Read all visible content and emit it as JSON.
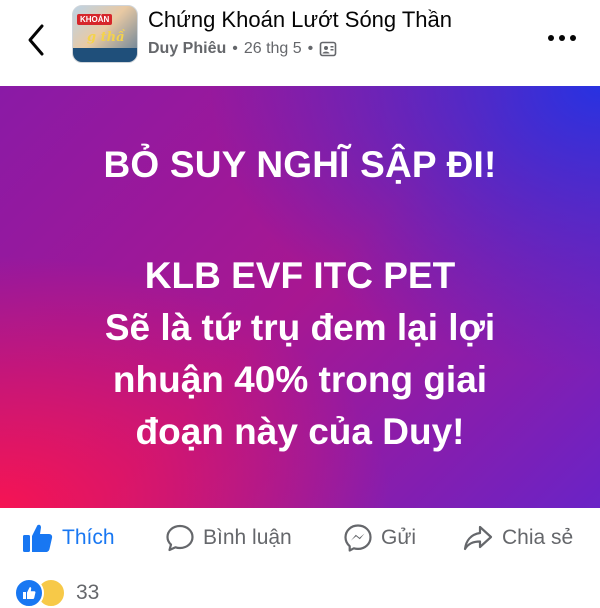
{
  "header": {
    "group_name": "Chứng Khoán Lướt Sóng Thần",
    "author": "Duy Phiêu",
    "separator": "•",
    "date": "26 thg 5",
    "icons": {
      "back": "back-chevron-icon",
      "privacy": "group-privacy-icon",
      "more": "more-dots-icon"
    }
  },
  "avatar": {
    "tag_text": "KHOÁN",
    "script_text": "g thầ"
  },
  "post": {
    "line1": "BỎ SUY NGHĨ SẬP ĐI!",
    "line2": "KLB EVF ITC PET",
    "line3": "Sẽ là tứ trụ đem lại lợi",
    "line4": "nhuận 40% trong giai",
    "line5": "đoạn này của Duy!",
    "colors": {
      "text": "#ffffff",
      "gradient_pink": "#fa1450",
      "gradient_purple": "#a81791",
      "gradient_blue": "#2832e1"
    }
  },
  "actions": {
    "like": "Thích",
    "comment": "Bình luận",
    "send": "Gửi",
    "share": "Chia sẻ",
    "like_color": "#1877f2"
  },
  "reactions": {
    "count": "33",
    "icons": [
      "like-reaction-icon",
      "haha-reaction-icon"
    ]
  }
}
